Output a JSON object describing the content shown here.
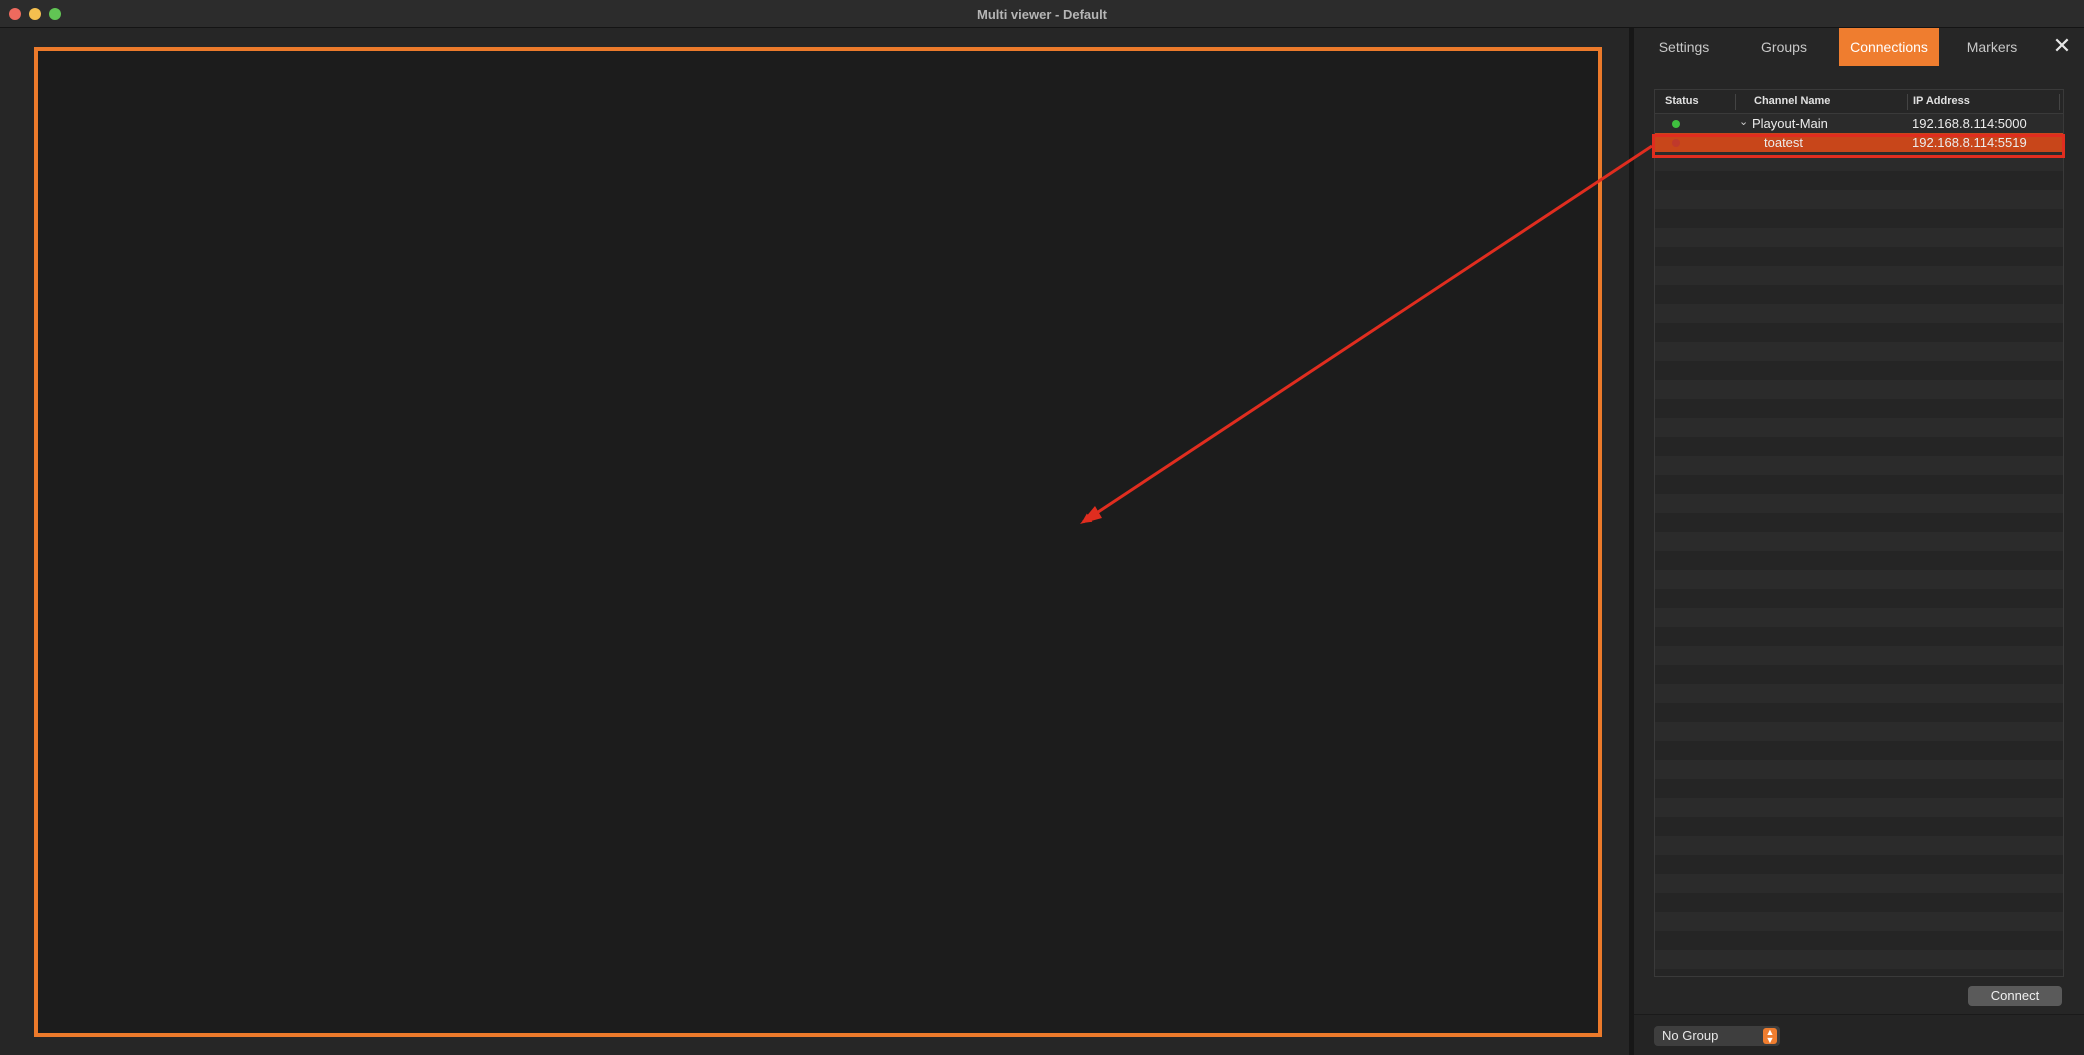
{
  "window": {
    "title": "Multi viewer - Default"
  },
  "tabs": [
    {
      "label": "Settings",
      "active": false
    },
    {
      "label": "Groups",
      "active": false
    },
    {
      "label": "Connections",
      "active": true
    },
    {
      "label": "Markers",
      "active": false
    }
  ],
  "close_icon": "✕",
  "table": {
    "columns": [
      "Status",
      "Channel Name",
      "IP Address"
    ],
    "rows": [
      {
        "status": "connected",
        "status_color": "#3fbf3f",
        "channel": "Playout-Main",
        "ip": "192.168.8.114:5000",
        "expanded": true,
        "selected": false
      },
      {
        "status": "disconnected",
        "status_color": "#c0392b",
        "channel": "toatest",
        "ip": "192.168.8.114:5519",
        "selected": true
      }
    ]
  },
  "buttons": {
    "connect": "Connect"
  },
  "group_select": {
    "value": "No Group"
  },
  "colors": {
    "accent": "#ef7d2f",
    "annotation": "#e02d1f"
  }
}
